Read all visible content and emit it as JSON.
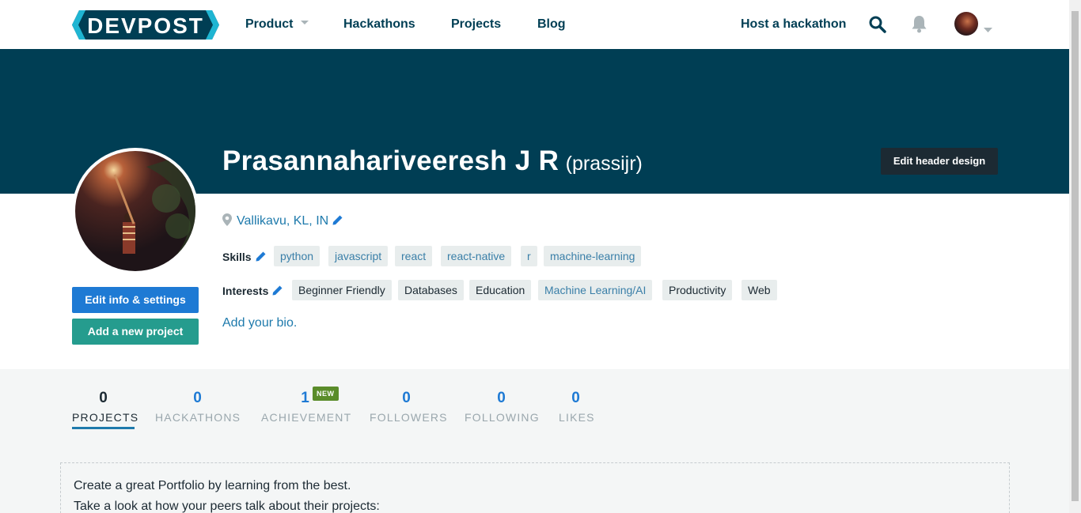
{
  "nav": {
    "logo_text": "DEVPOST",
    "product": "Product",
    "hackathons": "Hackathons",
    "projects": "Projects",
    "blog": "Blog",
    "host": "Host a hackathon"
  },
  "header": {
    "edit_header_label": "Edit header design"
  },
  "profile": {
    "name": "Prasannahariveeresh J R",
    "handle": "(prassijr)",
    "location": "Vallikavu, KL, IN",
    "skills_label": "Skills",
    "skills": [
      "python",
      "javascript",
      "react",
      "react-native",
      "r",
      "machine-learning"
    ],
    "interests_label": "Interests",
    "interests": [
      "Beginner Friendly",
      "Databases",
      "Education",
      "Machine Learning/AI",
      "Productivity",
      "Web"
    ],
    "bio_link": "Add your bio.",
    "edit_info_label": "Edit info & settings",
    "add_project_label": "Add a new project"
  },
  "stats": [
    {
      "value": "0",
      "label": "PROJECTS"
    },
    {
      "value": "0",
      "label": "HACKATHONS"
    },
    {
      "value": "1",
      "label": "ACHIEVEMENT",
      "badge": "NEW"
    },
    {
      "value": "0",
      "label": "FOLLOWERS"
    },
    {
      "value": "0",
      "label": "FOLLOWING"
    },
    {
      "value": "0",
      "label": "LIKES"
    }
  ],
  "portfolio": {
    "line1": "Create a great Portfolio by learning from the best.",
    "line2": "Take a look at how your peers talk about their projects:"
  },
  "colors": {
    "brand_dark": "#003e54",
    "link_blue": "#1e7aac",
    "button_blue": "#1e7ad4",
    "button_green": "#259c8e",
    "badge_green": "#5a8c2a"
  }
}
